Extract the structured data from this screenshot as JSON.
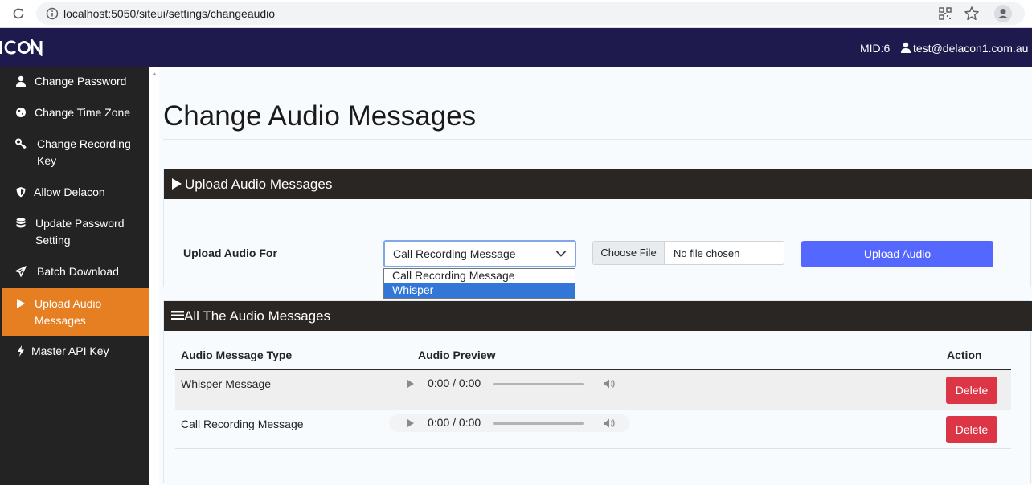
{
  "browser": {
    "url": "localhost:5050/siteui/settings/changeaudio"
  },
  "header": {
    "logo": "ICON",
    "mid": "MID:6",
    "user_email": "test@delacon1.com.au"
  },
  "sidebar": {
    "items": [
      {
        "label": "Change Password",
        "icon": "user-icon"
      },
      {
        "label": "Change Time Zone",
        "icon": "globe-icon"
      },
      {
        "label": "Change Recording Key",
        "icon": "key-icon"
      },
      {
        "label": "Allow Delacon",
        "icon": "shield-icon"
      },
      {
        "label": "Update Password Setting",
        "icon": "database-icon"
      },
      {
        "label": "Batch Download",
        "icon": "paper-plane-icon"
      },
      {
        "label": "Upload Audio Messages",
        "icon": "play-icon",
        "active": true
      },
      {
        "label": "Master API Key",
        "icon": "bolt-icon"
      }
    ]
  },
  "main": {
    "title": "Change Audio Messages",
    "upload_card": {
      "heading": "Upload Audio Messages",
      "upload_for_label": "Upload Audio For",
      "select_value": "Call Recording Message",
      "options": [
        "Call Recording Message",
        "Whisper"
      ],
      "highlighted_option": "Whisper",
      "file_button": "Choose File",
      "file_status": "No file chosen",
      "upload_button": "Upload Audio"
    },
    "list_card": {
      "heading": "All The Audio Messages",
      "columns": [
        "Audio Message Type",
        "Audio Preview",
        "Action"
      ],
      "rows": [
        {
          "type": "Whisper Message",
          "time": "0:00 / 0:00",
          "action": "Delete"
        },
        {
          "type": "Call Recording Message",
          "time": "0:00 / 0:00",
          "action": "Delete"
        }
      ]
    }
  },
  "colors": {
    "header_bg": "#1e1a4e",
    "sidebar_bg": "#232323",
    "sidebar_active": "#e67e22",
    "card_head_bg": "#2a2623",
    "upload_button": "#5468ff",
    "delete_button": "#dc3545"
  }
}
